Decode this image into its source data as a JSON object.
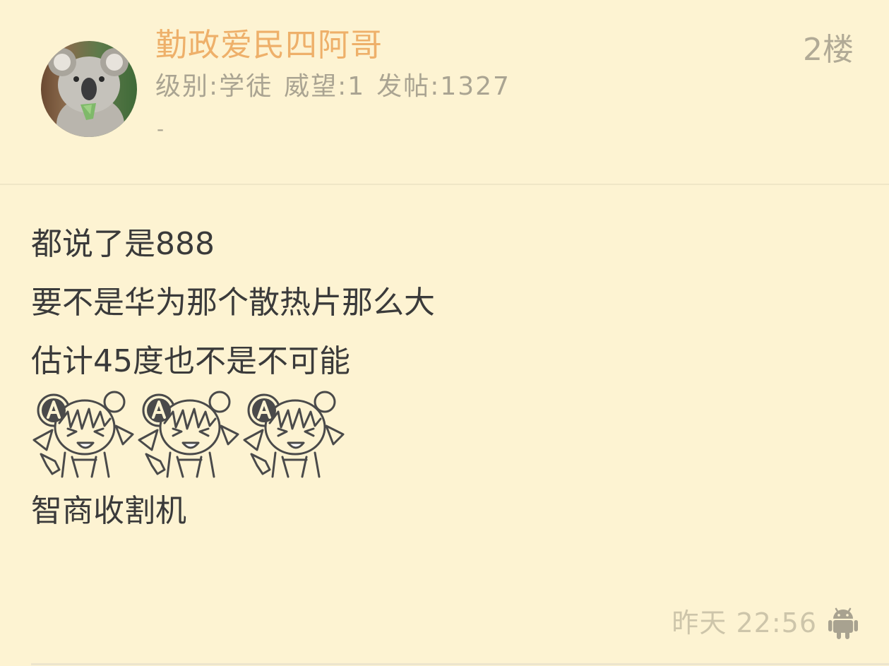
{
  "post": {
    "username": "勤政爱民四阿哥",
    "level": "级别:学徒",
    "prestige": "威望:1",
    "posts": "发帖:1327",
    "signature": "-",
    "floor": "2楼",
    "avatar_icon": "koala-avatar",
    "content": {
      "line1": "都说了是888",
      "line2": "要不是华为那个散热片那么大",
      "line3": "估计45度也不是不可能",
      "sticker_count": 3,
      "sticker_icon": "anime-girl-laughing-sticker",
      "line4": "智商收割机"
    },
    "time": "昨天 22:56",
    "device_icon": "android-icon"
  },
  "colors": {
    "background": "#fdf3d2",
    "username": "#eeb06a",
    "meta": "#aaa492",
    "body_text": "#3a3a3a",
    "time": "#cdc5aa"
  }
}
